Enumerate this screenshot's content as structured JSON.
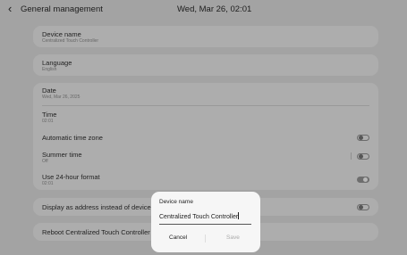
{
  "header": {
    "back_icon": "chevron-left-icon",
    "title": "General management",
    "datetime": "Wed, Mar 26, 02:01"
  },
  "device_name_row": {
    "label": "Device name",
    "value": "Centralized Touch Controller"
  },
  "language_row": {
    "label": "Language",
    "value": "English"
  },
  "settings": {
    "date_label": "Date",
    "date_value": "Wed, Mar 26, 2025",
    "time_label": "Time",
    "time_value": "02:01",
    "auto_tz_label": "Automatic time zone",
    "auto_tz_on": false,
    "summer_label": "Summer time",
    "summer_value": "Off",
    "summer_on": false,
    "h24_label": "Use 24-hour format",
    "h24_value": "02:01",
    "h24_on": true
  },
  "address_row": {
    "label": "Display as address instead of device na",
    "on": false
  },
  "reboot_row": {
    "label": "Reboot Centralized Touch Controller"
  },
  "dialog": {
    "title": "Device name",
    "input_value": "Centralized Touch Controller",
    "cancel_label": "Cancel",
    "save_label": "Save"
  },
  "colors": {
    "dim_background": "#a3a3a3",
    "card": "#adadad",
    "dialog": "#f6f6f6",
    "text": "#1d1d1d",
    "disabled": "#aaaaaa"
  }
}
